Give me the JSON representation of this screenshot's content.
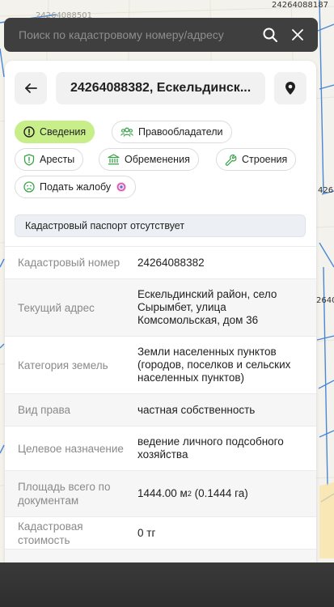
{
  "map": {
    "labels": [
      "24264088187",
      "24264088501"
    ],
    "side_labels": [
      "426",
      "2640"
    ],
    "accent_line_color": "#4a87d6"
  },
  "search": {
    "placeholder": "Поиск по кадастровому номеру/адресу",
    "icons": [
      "search-icon",
      "close-icon"
    ]
  },
  "panel": {
    "title": "24264088382, Ескельдинск...",
    "icons": [
      "arrow-left-icon",
      "map-pin-icon"
    ],
    "tabs": [
      {
        "label": "Сведения",
        "icon": "info-circle-icon",
        "active": true
      },
      {
        "label": "Правообладатели",
        "icon": "users-icon",
        "active": false
      },
      {
        "label": "Аресты",
        "icon": "shield-alert-icon",
        "active": false
      },
      {
        "label": "Обременения",
        "icon": "bank-icon",
        "active": false
      },
      {
        "label": "Строения",
        "icon": "wrench-icon",
        "active": false
      },
      {
        "label": "Подать жалобу",
        "icon": "sad-face-icon",
        "active": false
      }
    ],
    "active_tab_color": "#c8ee8a",
    "notice": "Кадастровый паспорт отсутствует",
    "rows": [
      {
        "label": "Кадастровый номер",
        "value": "24264088382"
      },
      {
        "label": "Текущий адрес",
        "value": "Ескельдинский район, село Сырымбет, улица Комсомольская, дом 36"
      },
      {
        "label": "Категория земель",
        "value": "Земли населенных пунктов (городов, поселков и сельских населенных пунктов)"
      },
      {
        "label": "Вид права",
        "value": "частная собственность"
      },
      {
        "label": "Целевое назначение",
        "value": "ведение личного подсобного хозяйства"
      },
      {
        "label": "Площадь всего по документам",
        "value_main": "1444.00 м",
        "value_sup": "2",
        "value_rest": " (0.1444 га)"
      },
      {
        "label": "Кадастровая стоимость",
        "value": "0 тг"
      }
    ]
  }
}
